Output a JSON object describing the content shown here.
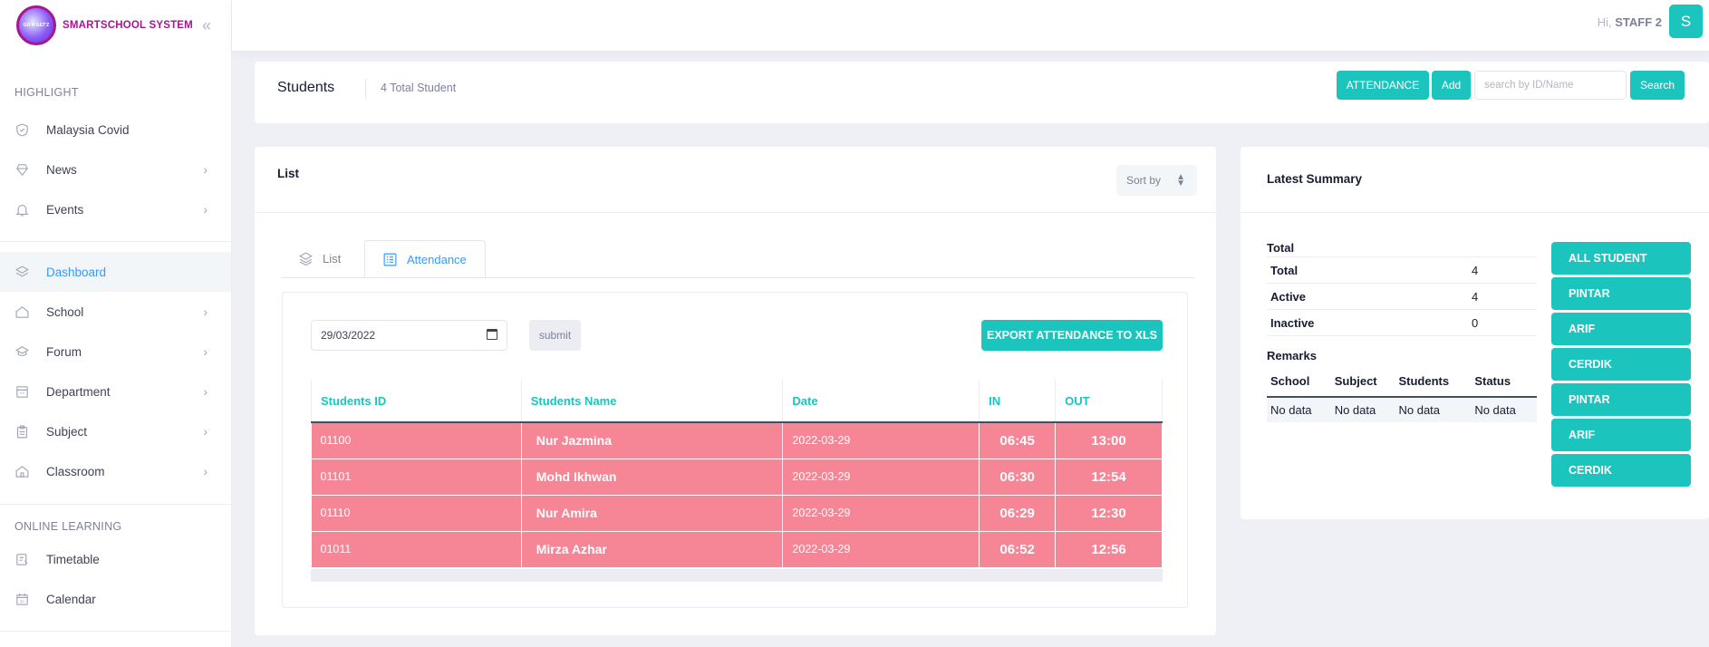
{
  "brand": {
    "name": "SMARTSCHOOL SYSTEM",
    "logo_text": "GO N GET'Z"
  },
  "sidebar": {
    "sections": [
      "HIGHLIGHT",
      "ONLINE LEARNING"
    ],
    "items": [
      {
        "label": "Malaysia Covid",
        "icon": "shield-icon"
      },
      {
        "label": "News",
        "icon": "news-icon"
      },
      {
        "label": "Events",
        "icon": "bell-icon"
      },
      {
        "label": "Dashboard",
        "icon": "layers-icon",
        "active": true
      },
      {
        "label": "School",
        "icon": "home-icon"
      },
      {
        "label": "Forum",
        "icon": "forum-icon"
      },
      {
        "label": "Department",
        "icon": "department-icon"
      },
      {
        "label": "Subject",
        "icon": "clipboard-icon"
      },
      {
        "label": "Classroom",
        "icon": "classroom-icon"
      },
      {
        "label": "Timetable",
        "icon": "timetable-icon"
      },
      {
        "label": "Calendar",
        "icon": "calendar-icon"
      }
    ]
  },
  "topbar": {
    "greeting": "Hi,",
    "user": "STAFF 2",
    "avatar": "S"
  },
  "subheader": {
    "title": "Students",
    "count": "4 Total Student",
    "attendance_btn": "ATTENDANCE",
    "add_btn": "Add",
    "search_placeholder": "search by ID/Name",
    "search_btn": "Search"
  },
  "list_card": {
    "title": "List",
    "sort_label": "Sort by",
    "tabs": [
      "List",
      "Attendance"
    ],
    "active_tab": "Attendance",
    "date_value": "29/03/2022",
    "submit_label": "submit",
    "export_label": "EXPORT ATTENDANCE TO XLS",
    "table": {
      "headers": [
        "Students ID",
        "Students Name",
        "Date",
        "IN",
        "OUT"
      ],
      "rows": [
        [
          "01100",
          "Nur Jazmina",
          "2022-03-29",
          "06:45",
          "13:00"
        ],
        [
          "01101",
          "Mohd Ikhwan",
          "2022-03-29",
          "06:30",
          "12:54"
        ],
        [
          "01110",
          "Nur Amira",
          "2022-03-29",
          "06:29",
          "12:30"
        ],
        [
          "01011",
          "Mirza Azhar",
          "2022-03-29",
          "06:52",
          "12:56"
        ]
      ]
    }
  },
  "summary": {
    "title": "Latest Summary",
    "total_heading": "Total",
    "totals": [
      {
        "label": "Total",
        "value": "4"
      },
      {
        "label": "Active",
        "value": "4"
      },
      {
        "label": "Inactive",
        "value": "0"
      }
    ],
    "remarks_heading": "Remarks",
    "remarks_headers": [
      "School",
      "Subject",
      "Students",
      "Status"
    ],
    "remarks_row": [
      "No data",
      "No data",
      "No data",
      "No data"
    ],
    "buttons": [
      "ALL STUDENT",
      "PINTAR",
      "ARIF",
      "CERDIK",
      "PINTAR",
      "ARIF",
      "CERDIK"
    ]
  },
  "colors": {
    "accent": "#1bc5bd",
    "link": "#3699ff",
    "row_bg": "#f68695",
    "brand": "#a6168f"
  }
}
